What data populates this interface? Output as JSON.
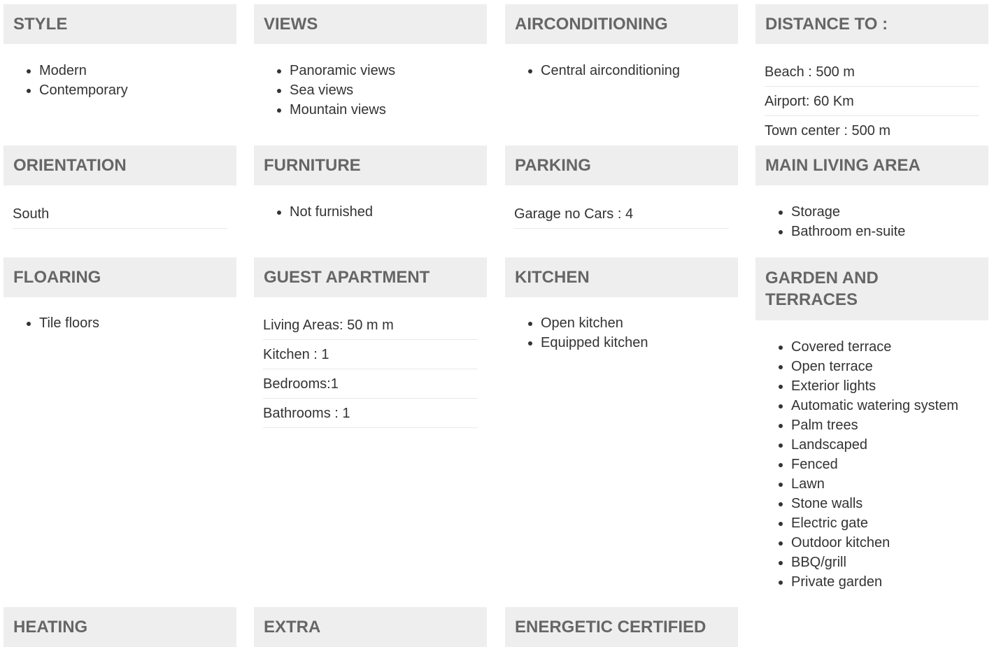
{
  "style": {
    "title": "STYLE",
    "items": [
      "Modern",
      "Contemporary"
    ]
  },
  "views": {
    "title": "VIEWS",
    "items": [
      "Panoramic views",
      "Sea views",
      "Mountain views"
    ]
  },
  "airconditioning": {
    "title": "AIRCONDITIONING",
    "items": [
      "Central airconditioning"
    ]
  },
  "distance": {
    "title": "DISTANCE TO :",
    "rows": [
      "Beach : 500 m",
      "Airport: 60 Km",
      "Town center : 500 m"
    ]
  },
  "orientation": {
    "title": "ORIENTATION",
    "rows": [
      "South"
    ]
  },
  "furniture": {
    "title": "FURNITURE",
    "items": [
      "Not furnished"
    ]
  },
  "parking": {
    "title": "PARKING",
    "rows": [
      "Garage no Cars : 4"
    ]
  },
  "main_living": {
    "title": "MAIN LIVING AREA",
    "items": [
      "Storage",
      "Bathroom en-suite"
    ]
  },
  "flooring": {
    "title": "FLOARING",
    "items": [
      "Tile floors"
    ]
  },
  "guest": {
    "title": "GUEST APARTMENT",
    "rows": [
      "Living Areas: 50 m m",
      "Kitchen : 1",
      "Bedrooms:1",
      "Bathrooms : 1"
    ]
  },
  "kitchen": {
    "title": "KITCHEN",
    "items": [
      "Open kitchen",
      "Equipped kitchen"
    ]
  },
  "garden": {
    "title_line1": "GARDEN AND",
    "title_line2": "TERRACES",
    "items": [
      "Covered terrace",
      "Open terrace",
      "Exterior lights",
      "Automatic watering system",
      "Palm trees",
      "Landscaped",
      "Fenced",
      "Lawn",
      "Stone walls",
      "Electric gate",
      "Outdoor kitchen",
      "BBQ/grill",
      "Private garden"
    ]
  },
  "heating": {
    "title": "HEATING"
  },
  "extra": {
    "title": "EXTRA"
  },
  "energetic": {
    "title": "ENERGETIC CERTIFIED"
  }
}
